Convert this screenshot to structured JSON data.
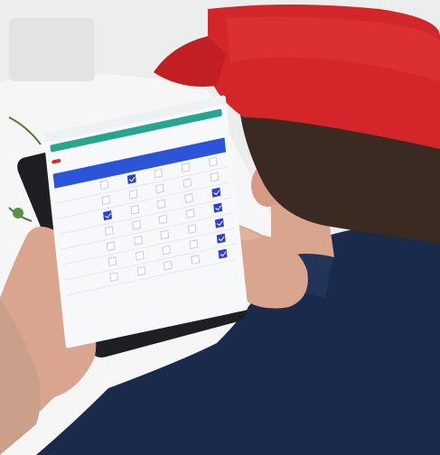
{
  "photo": {
    "subject": "",
    "screen": {
      "top_bar_label": "",
      "red_button_label": "",
      "subheading": "",
      "table": {
        "columns": [
          "",
          "",
          "",
          "",
          ""
        ],
        "rows": [
          {
            "label": "",
            "checked": [
              false,
              true,
              false,
              false,
              false
            ]
          },
          {
            "label": "",
            "checked": [
              false,
              false,
              false,
              false,
              false
            ]
          },
          {
            "label": "",
            "checked": [
              true,
              false,
              false,
              false,
              true
            ]
          },
          {
            "label": "",
            "checked": [
              false,
              false,
              false,
              false,
              true
            ]
          },
          {
            "label": "",
            "checked": [
              false,
              false,
              false,
              false,
              true
            ]
          },
          {
            "label": "",
            "checked": [
              false,
              false,
              false,
              false,
              true
            ]
          },
          {
            "label": "",
            "checked": [
              false,
              false,
              false,
              false,
              true
            ]
          }
        ]
      }
    }
  },
  "colors": {
    "cap_red": "#d3252a",
    "shirt_navy": "#1a2a4a",
    "tablet_bezel": "#1e1f23",
    "screen_bg": "#f7f8fa",
    "table_header_blue": "#2b55d6",
    "checkbox_blue": "#2f3fd1",
    "teal_bar": "#26a58f",
    "red_button": "#cf2b2b"
  }
}
